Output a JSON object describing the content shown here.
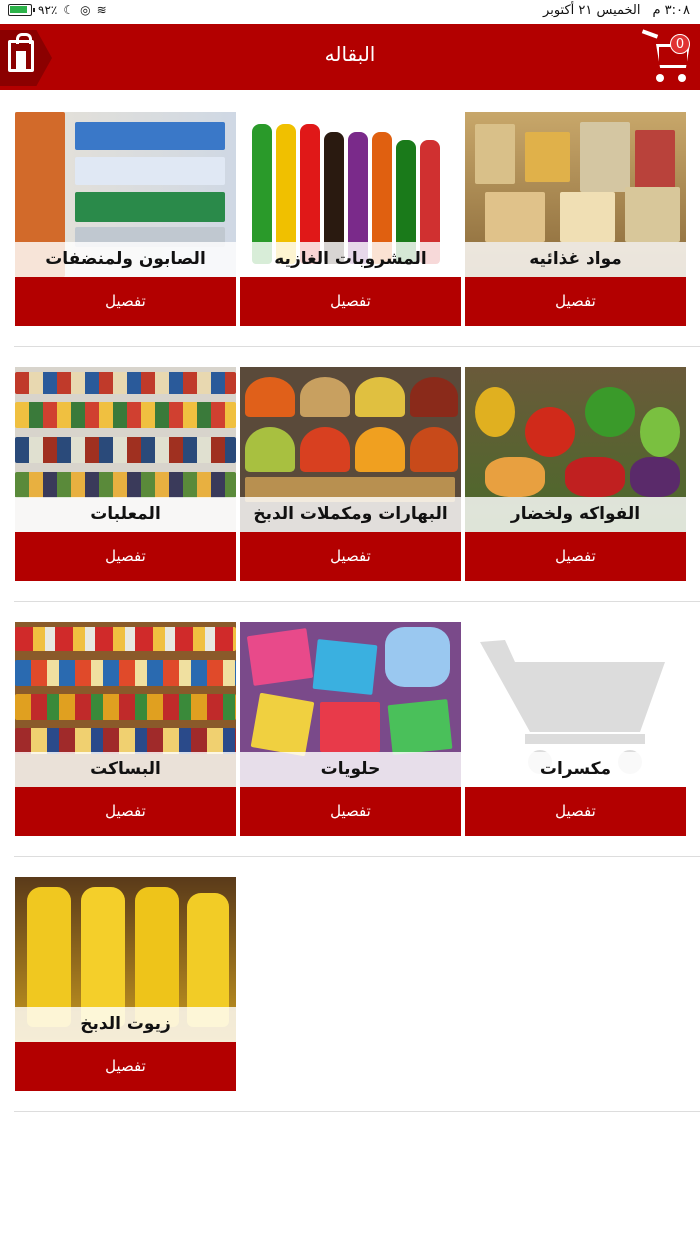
{
  "status": {
    "time": "٣:٠٨ م",
    "date": "الخميس ٢١ أكتوبر",
    "battery": "٩٢٪"
  },
  "header": {
    "title": "البقاله",
    "cart_count": "0"
  },
  "categories": [
    {
      "label": "مواد غذائيه",
      "button": "تفصيل"
    },
    {
      "label": "المشروبات الغازيه",
      "button": "تفصيل"
    },
    {
      "label": "الصابون ولمنضفات",
      "button": "تفصيل"
    },
    {
      "label": "الفواكه ولخضار",
      "button": "تفصيل"
    },
    {
      "label": "البهارات ومكملات الدبخ",
      "button": "تفصيل"
    },
    {
      "label": "المعلبات",
      "button": "تفصيل"
    },
    {
      "label": "مكسرات",
      "button": "تفصيل"
    },
    {
      "label": "حلويات",
      "button": "تفصيل"
    },
    {
      "label": "البساكت",
      "button": "تفصيل"
    },
    {
      "label": "زيوت الدبخ",
      "button": "تفصيل"
    }
  ]
}
